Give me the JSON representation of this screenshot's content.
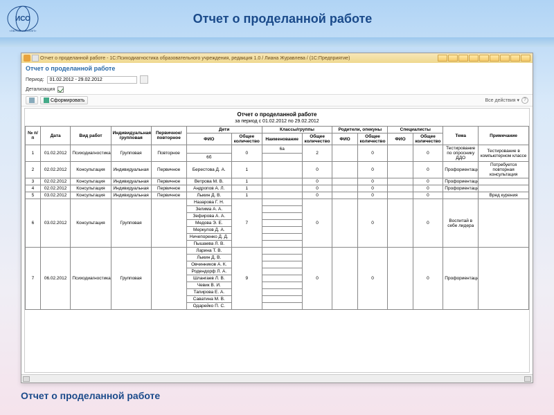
{
  "slide": {
    "title": "Отчет о проделанной работе",
    "caption": "Отчет о проделанной работе"
  },
  "window": {
    "title": "Отчет о проделанной работе - 1С:Психодиагностика образовательного учреждения, редакция 1.0 / Лиана Журавлева /  (1С:Предприятие)",
    "report_tab": "Отчет о проделанной работе"
  },
  "params": {
    "period_label": "Период:",
    "period_value": "01.02.2012 - 29.02.2012",
    "detail_label": "Детализация"
  },
  "toolbar": {
    "form": "Сформировать",
    "all_actions": "Все действия ▾"
  },
  "report": {
    "title": "Отчет о проделанной работе",
    "period": "за период с 01.02.2012 по 29.02.2012",
    "headers": {
      "n": "№ п/п",
      "date": "Дата",
      "work": "Вид работ",
      "ind_group": "Индивидуальная/групповая",
      "prim_rep": "Первичное/повторное",
      "children": "Дети",
      "classes": "Классы/группы",
      "parents": "Родители, опекуны",
      "specialists": "Специалисты",
      "fio": "ФИО",
      "count": "Общее количество",
      "name": "Наименование",
      "theme": "Тема",
      "note": "Примечание"
    },
    "rows": [
      {
        "n": "1",
        "date": "01.02.2012",
        "work": "Психодиагностика",
        "ig": "Групповая",
        "pr": "Повторное",
        "child_fio": "",
        "child_cnt": "0",
        "class_name": "6а",
        "class_cnt": "2",
        "parent_fio": "",
        "parent_cnt": "0",
        "spec_fio": "",
        "spec_cnt": "0",
        "theme": "Тестирование по опроснику ДДО",
        "note": "Тестирование в компьютерном классе",
        "extra": [
          "6б"
        ]
      },
      {
        "n": "2",
        "date": "02.02.2012",
        "work": "Консультация",
        "ig": "Индивидуальная",
        "pr": "Первичное",
        "child_fio": "Берестова Д. А.",
        "child_cnt": "1",
        "class_name": "",
        "class_cnt": "0",
        "parent_fio": "",
        "parent_cnt": "0",
        "spec_fio": "",
        "spec_cnt": "0",
        "theme": "Профориентация",
        "note": "Потребуется повторная консультация"
      },
      {
        "n": "3",
        "date": "02.02.2012",
        "work": "Консультация",
        "ig": "Индивидуальная",
        "pr": "Первичное",
        "child_fio": "Ветрова М. В.",
        "child_cnt": "1",
        "class_name": "",
        "class_cnt": "0",
        "parent_fio": "",
        "parent_cnt": "0",
        "spec_fio": "",
        "spec_cnt": "0",
        "theme": "Профориентация",
        "note": ""
      },
      {
        "n": "4",
        "date": "02.02.2012",
        "work": "Консультация",
        "ig": "Индивидуальная",
        "pr": "Первичное",
        "child_fio": "Андропов А. Л.",
        "child_cnt": "1",
        "class_name": "",
        "class_cnt": "0",
        "parent_fio": "",
        "parent_cnt": "0",
        "spec_fio": "",
        "spec_cnt": "0",
        "theme": "Профориентация",
        "note": ""
      },
      {
        "n": "5",
        "date": "03.02.2012",
        "work": "Консультация",
        "ig": "Индивидуальная",
        "pr": "Первичное",
        "child_fio": "Лыкин Д. В.",
        "child_cnt": "1",
        "class_name": "",
        "class_cnt": "0",
        "parent_fio": "",
        "parent_cnt": "0",
        "spec_fio": "",
        "spec_cnt": "0",
        "theme": "",
        "note": "Вред курения"
      },
      {
        "n": "6",
        "date": "03.02.2012",
        "work": "Консультация",
        "ig": "Групповая",
        "pr": "",
        "child_fio": "Назарова Г. Н.",
        "child_cnt": "7",
        "class_name": "",
        "class_cnt": "0",
        "parent_fio": "",
        "parent_cnt": "0",
        "spec_fio": "",
        "spec_cnt": "0",
        "theme": "Воспитай в себе лидера",
        "note": "",
        "extra": [
          "Зелима А. А.",
          "Зефирова А. А.",
          "Медова Э. Е.",
          "Меркулов Д. А.",
          "Ничепоренко Д. Д.",
          "Пышаева Л. В."
        ]
      },
      {
        "n": "7",
        "date": "06.02.2012",
        "work": "Психодиагностика",
        "ig": "Групповая",
        "pr": "",
        "child_fio": "Ларина Т. В.",
        "child_cnt": "9",
        "class_name": "",
        "class_cnt": "0",
        "parent_fio": "",
        "parent_cnt": "0",
        "spec_fio": "",
        "spec_cnt": "0",
        "theme": "Профориентация",
        "note": "",
        "extra": [
          "Лыкин Д. В.",
          "Овчинников А. К.",
          "Родендорф Л. А.",
          "Шлангаев Л. В.",
          "Чевик В. И.",
          "Тапирова Е. А.",
          "Саватина М. В.",
          "Одарейко П. С."
        ]
      }
    ]
  }
}
